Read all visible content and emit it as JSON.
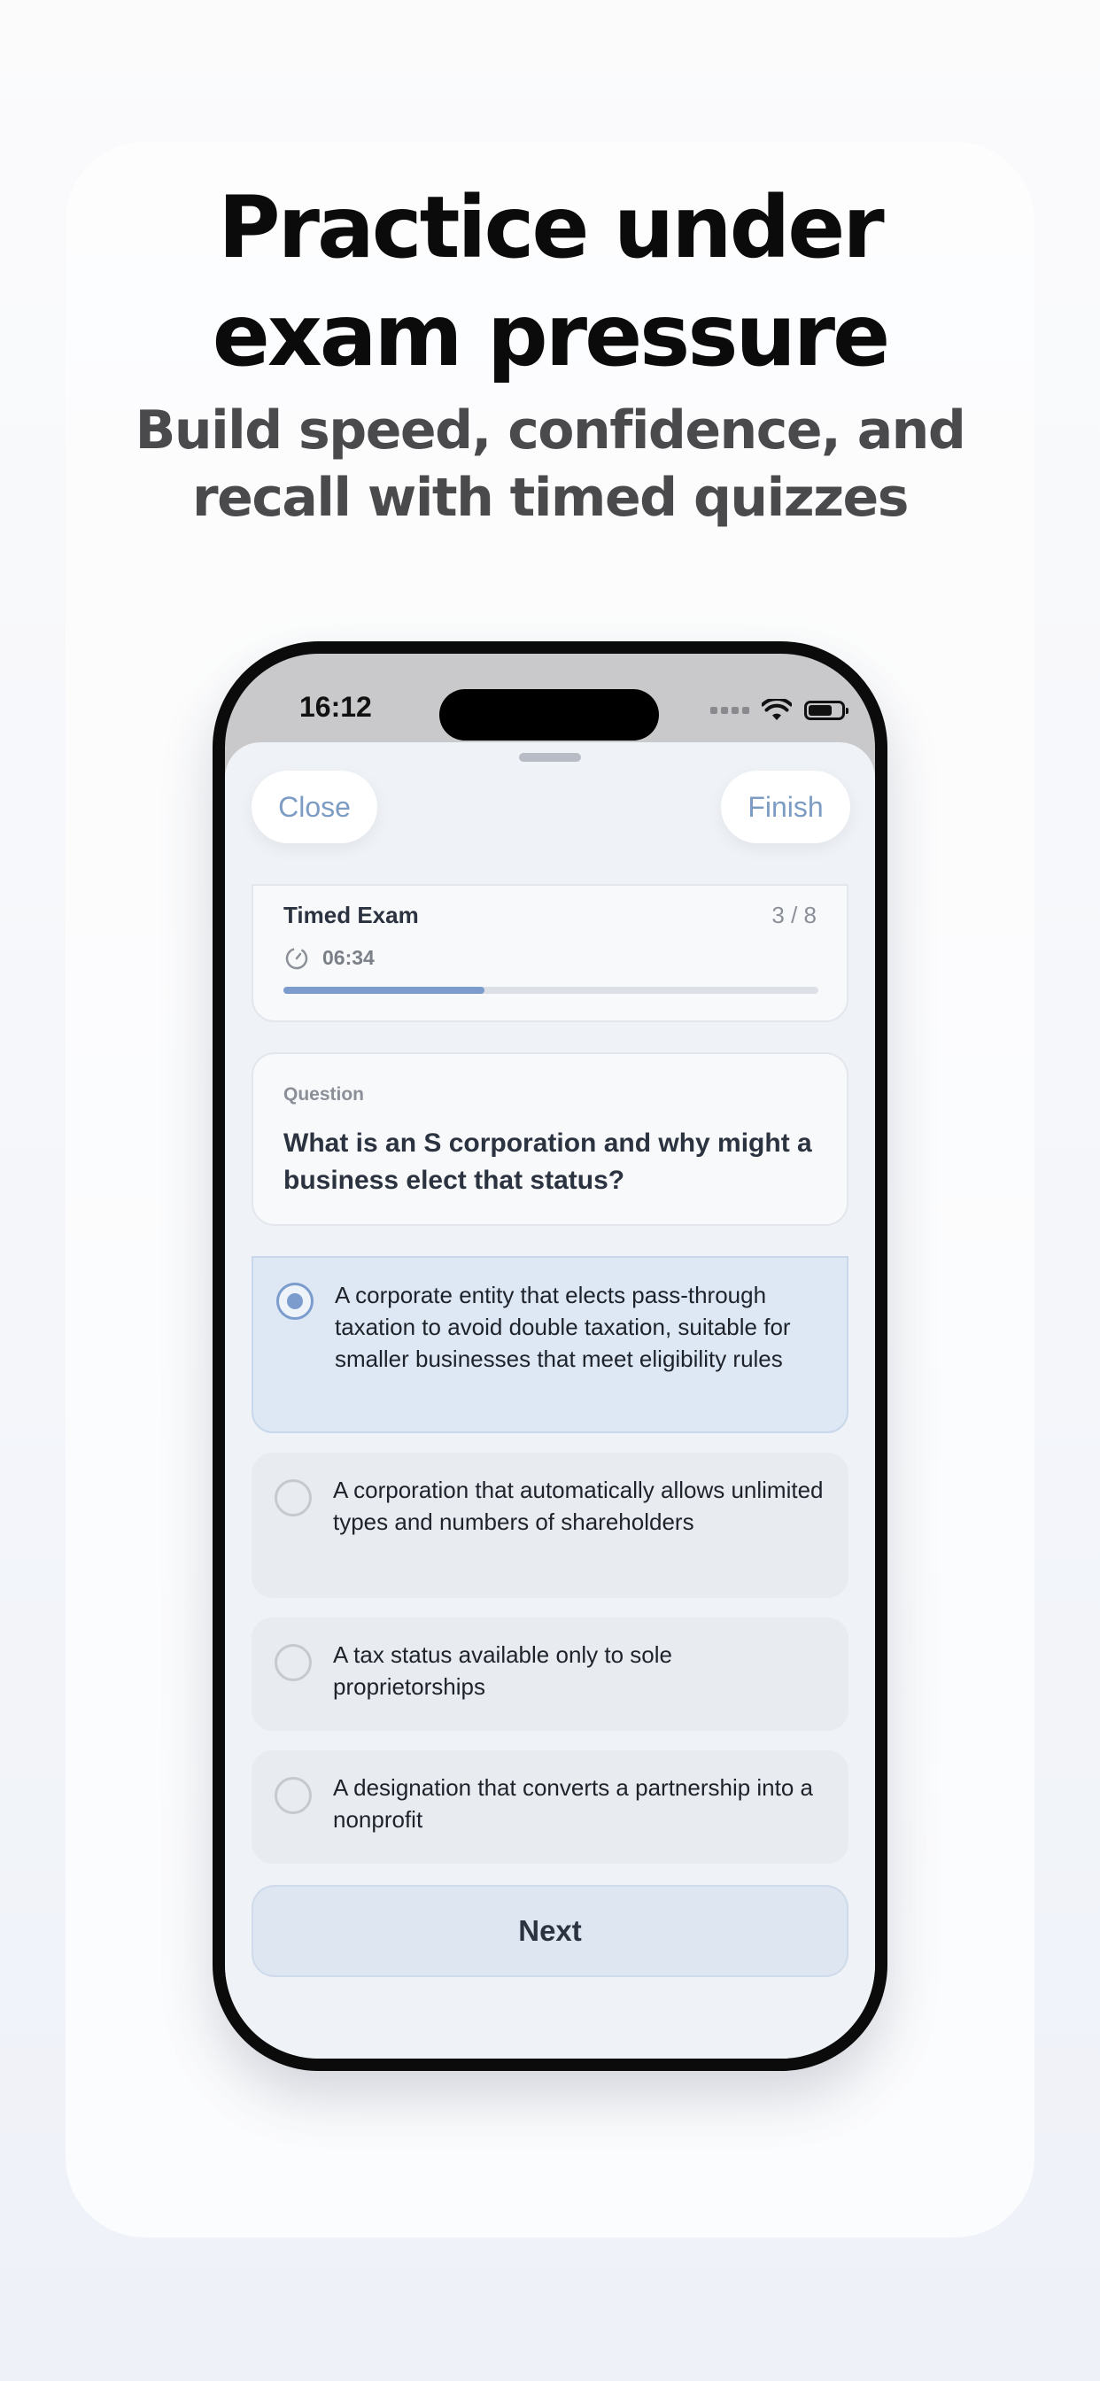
{
  "hero": {
    "title_line1": "Practice under",
    "title_line2": "exam pressure",
    "subtitle_line1": "Build speed, confidence, and",
    "subtitle_line2": "recall with timed quizzes"
  },
  "status_bar": {
    "time": "16:12",
    "icons": [
      "signal-icon",
      "wifi-icon",
      "battery-icon"
    ]
  },
  "toolbar": {
    "close_label": "Close",
    "finish_label": "Finish"
  },
  "exam": {
    "title": "Timed Exam",
    "counter": "3 / 8",
    "timer": "06:34",
    "timer_icon": "timer-icon",
    "progress": 0.375
  },
  "question": {
    "label": "Question",
    "text": "What is an S corporation and why might a business elect that status?"
  },
  "answers": [
    {
      "text": "A corporate entity that elects pass-through taxation to avoid double taxation, suitable for smaller businesses that meet eligibility rules",
      "selected": true
    },
    {
      "text": "A corporation that automatically allows unlimited types and numbers of shareholders",
      "selected": false
    },
    {
      "text": "A tax status available only to sole proprietorships",
      "selected": false
    },
    {
      "text": "A designation that converts a partnership into a nonprofit",
      "selected": false
    }
  ],
  "next_label": "Next",
  "colors": {
    "accent": "#7c9cce",
    "selected_bg": "#dde8f4",
    "button_text": "#7c9cc4"
  }
}
